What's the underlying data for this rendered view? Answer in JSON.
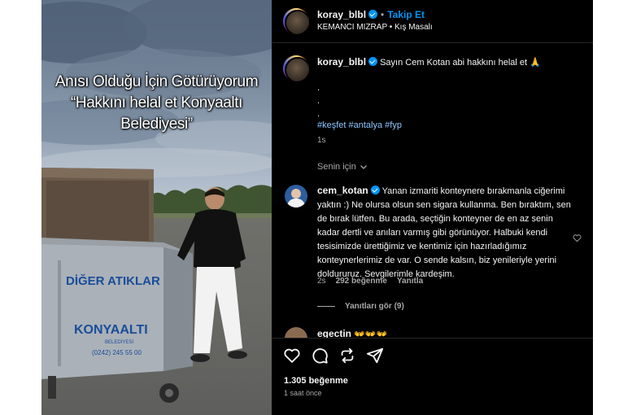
{
  "media": {
    "overlay_lines": [
      "Anısı Olduğu İçin Götürüyorum",
      "“Hakkını helal et Konyaaltı",
      "Belediyesi”"
    ],
    "bin_label_1": "DİĞER ATIKLAR",
    "bin_label_2": "KONYAALTI",
    "bin_label_3": "BELEDİYESİ",
    "bin_phone": "(0242) 245 55 00"
  },
  "header": {
    "username": "koray_blbl",
    "dot": "•",
    "follow_label": "Takip Et",
    "audio": "KEMANCI MIZRAP • Kış Masalı",
    "more_icon": "more-horizontal-icon"
  },
  "caption": {
    "username": "koray_blbl",
    "text": "Sayın Cem Kotan abi hakkını helal et 🙏",
    "dots": [
      ".",
      ".",
      "."
    ],
    "hashtags": "#keşfet #antalya #fyp",
    "time": "1s"
  },
  "sort": {
    "label": "Senin için",
    "icon": "chevron-down-icon"
  },
  "comments": [
    {
      "username": "cem_kotan",
      "text": "Yanan izmariti konteynere bırakmanla ciğerimi yaktın :) Ne olursa olsun sen sigara kullanma. Ben bıraktım, sen de bırak lütfen. Bu arada, seçtiğin konteyner de en az senin kadar dertli ve anıları varmış gibi görünüyor. Halbuki kendi tesisimizde ürettiğimiz ve kentimiz için hazırladığımız konteynerlerimiz de var. O sende kalsın, biz yenileriyle yerini doldururuz. Sevgilerimle kardeşim.",
      "time": "2s",
      "likes": "292 beğenme",
      "reply": "Yanıtla",
      "view_replies": "Yanıtları gör (9)"
    },
    {
      "username": "egectin",
      "text": "👐👐👐"
    }
  ],
  "actions": {
    "likes": "1.305 beğenme",
    "time": "1 saat önce"
  },
  "colors": {
    "background": "#000000",
    "accent": "#0095f6",
    "text_primary": "#f5f5f5",
    "text_secondary": "#a8a8a8",
    "hashtag": "#8ec5ff"
  }
}
